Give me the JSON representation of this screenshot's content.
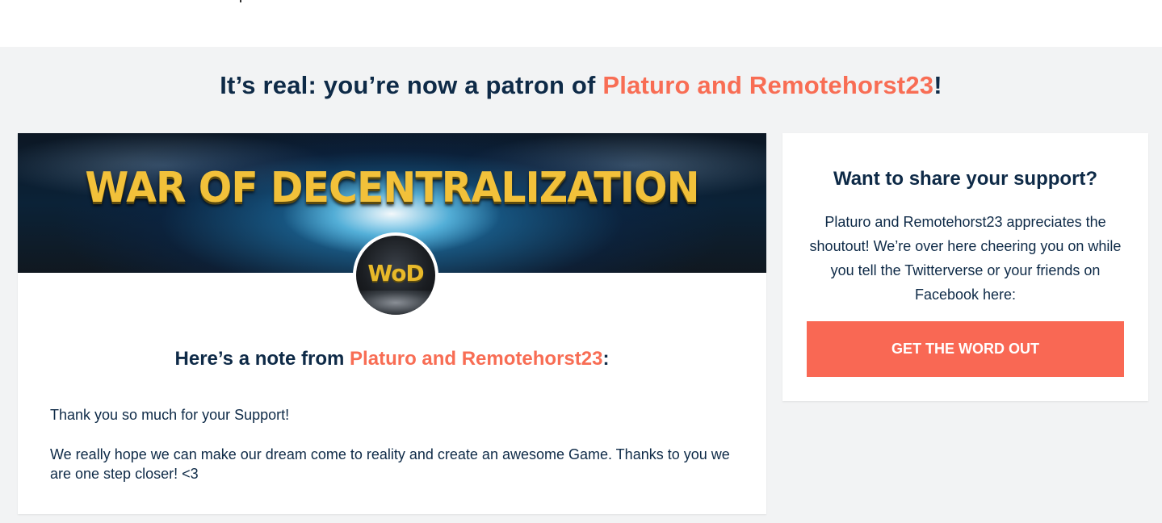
{
  "headline": {
    "prefix": "It’s real: you’re now a patron of ",
    "creator": "Platuro and Remotehorst23",
    "suffix": "!"
  },
  "banner": {
    "title": "WAR OF DECENTRALIZATION",
    "avatar_text": "WoD"
  },
  "note": {
    "heading_prefix": "Here’s a note from ",
    "creator": "Platuro and Remotehorst23",
    "heading_suffix": ":",
    "paragraphs": [
      "Thank you so much for your Support!",
      "We really hope we can make our dream come to reality and create an awesome Game. Thanks to you we are one step closer! <3"
    ]
  },
  "share": {
    "title": "Want to share your support?",
    "text": "Platuro and Remotehorst23 appreciates the shoutout! We’re over here cheering you on while you tell the Twitterverse or your friends on Facebook here:",
    "button_label": "GET THE WORD OUT"
  },
  "colors": {
    "accent": "#f86d54",
    "text": "#0e2a47",
    "background": "#f2f3f4",
    "button": "#f96854"
  }
}
